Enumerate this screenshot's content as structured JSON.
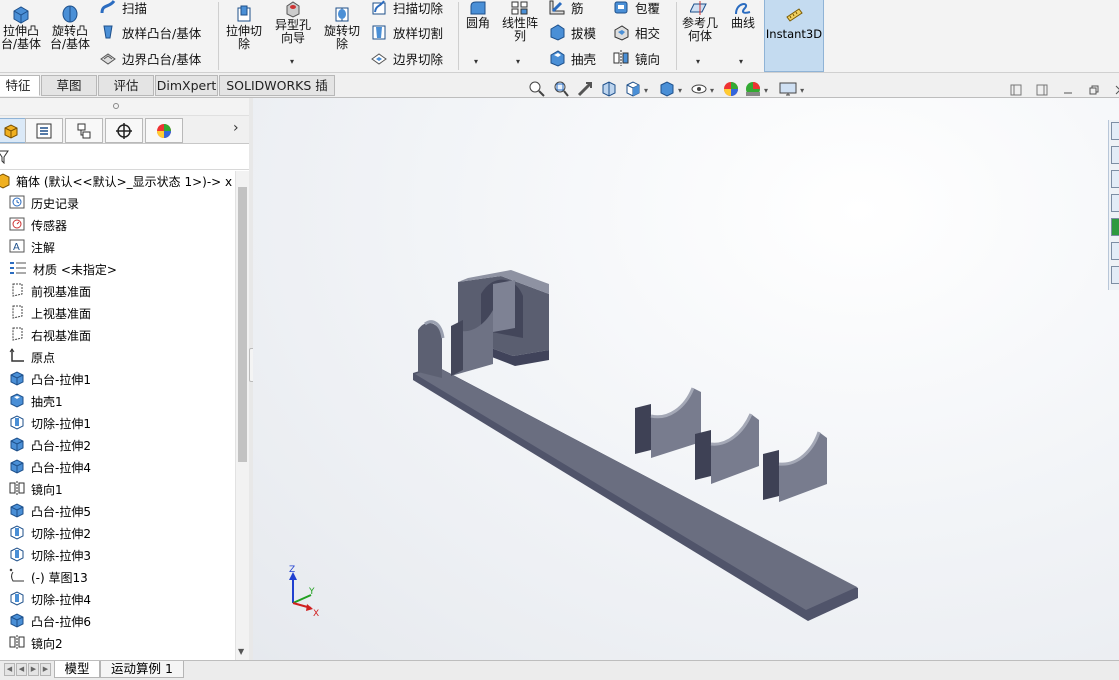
{
  "ribbon": {
    "extrude_boss": "拉伸凸\n台/基体",
    "revolve_boss": "旋转凸\n台/基体",
    "sweep": "扫描",
    "loft_boss": "放样凸台/基体",
    "boundary_boss": "边界凸台/基体",
    "extrude_cut": "拉伸切\n除",
    "hole_wizard": "异型孔\n向导",
    "revolve_cut": "旋转切\n除",
    "swept_cut": "扫描切除",
    "lofted_cut": "放样切割",
    "boundary_cut": "边界切除",
    "fillet": "圆角",
    "linear_pattern": "线性阵\n列",
    "rib": "筋",
    "draft": "拔模",
    "shell": "抽壳",
    "wrap": "包覆",
    "intersect": "相交",
    "mirror": "镜向",
    "ref_geometry": "参考几\n何体",
    "curves": "曲线",
    "instant3d": "Instant3D"
  },
  "tabs": [
    "特征",
    "草图",
    "评估",
    "DimXpert",
    "SOLIDWORKS 插件"
  ],
  "active_tab": "特征",
  "tree": {
    "root": "箱体 (默认<<默认>_显示状态 1>)-> x",
    "items": [
      {
        "label": "历史记录",
        "icon": "history-icon"
      },
      {
        "label": "传感器",
        "icon": "sensor-icon"
      },
      {
        "label": "注解",
        "icon": "annotation-icon"
      },
      {
        "label": "材质 <未指定>",
        "icon": "material-icon"
      },
      {
        "label": "前视基准面",
        "icon": "plane-icon"
      },
      {
        "label": "上视基准面",
        "icon": "plane-icon"
      },
      {
        "label": "右视基准面",
        "icon": "plane-icon"
      },
      {
        "label": "原点",
        "icon": "origin-icon"
      },
      {
        "label": "凸台-拉伸1",
        "icon": "boss-extrude-icon"
      },
      {
        "label": "抽壳1",
        "icon": "shell-icon"
      },
      {
        "label": "切除-拉伸1",
        "icon": "cut-extrude-icon"
      },
      {
        "label": "凸台-拉伸2",
        "icon": "boss-extrude-icon"
      },
      {
        "label": "凸台-拉伸4",
        "icon": "boss-extrude-icon"
      },
      {
        "label": "镜向1",
        "icon": "mirror-icon"
      },
      {
        "label": "凸台-拉伸5",
        "icon": "boss-extrude-icon"
      },
      {
        "label": "切除-拉伸2",
        "icon": "cut-extrude-icon"
      },
      {
        "label": "切除-拉伸3",
        "icon": "cut-extrude-icon"
      },
      {
        "label": "(-) 草图13",
        "icon": "sketch-icon"
      },
      {
        "label": "切除-拉伸4",
        "icon": "cut-extrude-icon"
      },
      {
        "label": "凸台-拉伸6",
        "icon": "boss-extrude-icon"
      },
      {
        "label": "镜向2",
        "icon": "mirror-icon"
      }
    ]
  },
  "triad": {
    "x": "X",
    "y": "Y",
    "z": "Z"
  },
  "bottom_tabs": [
    "模型",
    "运动算例 1"
  ],
  "colors": {
    "accent": "#c4dbf0",
    "model_face": "#5e6272",
    "model_light": "#8a8e9c",
    "axis_x": "#d02020",
    "axis_y": "#20a020",
    "axis_z": "#2040d0"
  }
}
